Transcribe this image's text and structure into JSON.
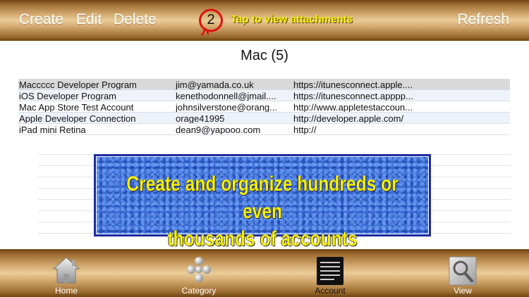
{
  "toolbar": {
    "create_label": "Create",
    "edit_label": "Edit",
    "delete_label": "Delete",
    "refresh_label": "Refresh",
    "attachment_count": "2",
    "attachment_hint": "Tap to view attachments"
  },
  "group": {
    "title": "Mac (5)"
  },
  "accounts": [
    {
      "name": "Maccccc Developer Program",
      "user": "jim@yamada.co.uk",
      "url": "https://itunesconnect.apple...."
    },
    {
      "name": "iOS Developer Program",
      "user": "kenethodonnell@jmail....",
      "url": "https://itunesconnect.apppp..."
    },
    {
      "name": "Mac App Store Test Account",
      "user": "johnsilverstone@orang...",
      "url": "http://www.appletestaccoun..."
    },
    {
      "name": "Apple Developer Connection",
      "user": "orage41995",
      "url": "http://developer.apple.com/"
    },
    {
      "name": "iPad mini Retina",
      "user": "dean9@yapooo.com",
      "url": "http://"
    }
  ],
  "promo": {
    "line1": "Create and organize hundreds or even",
    "line2": "thousands of accounts"
  },
  "tabs": [
    {
      "label": "Home",
      "icon": "house-icon"
    },
    {
      "label": "Category",
      "icon": "category-grid-icon"
    },
    {
      "label": "Account",
      "icon": "account-list-icon",
      "active": true
    },
    {
      "label": "View",
      "icon": "magnifier-icon"
    }
  ],
  "colors": {
    "toolbar_gold": "#d4aa70",
    "hint_yellow": "#f4f000",
    "badge_red": "#e01010",
    "promo_blue": "#3d6fd6",
    "promo_border": "#1b2a9e",
    "selected_row": "#d9d9d9",
    "alt_row": "#eef2fa"
  }
}
